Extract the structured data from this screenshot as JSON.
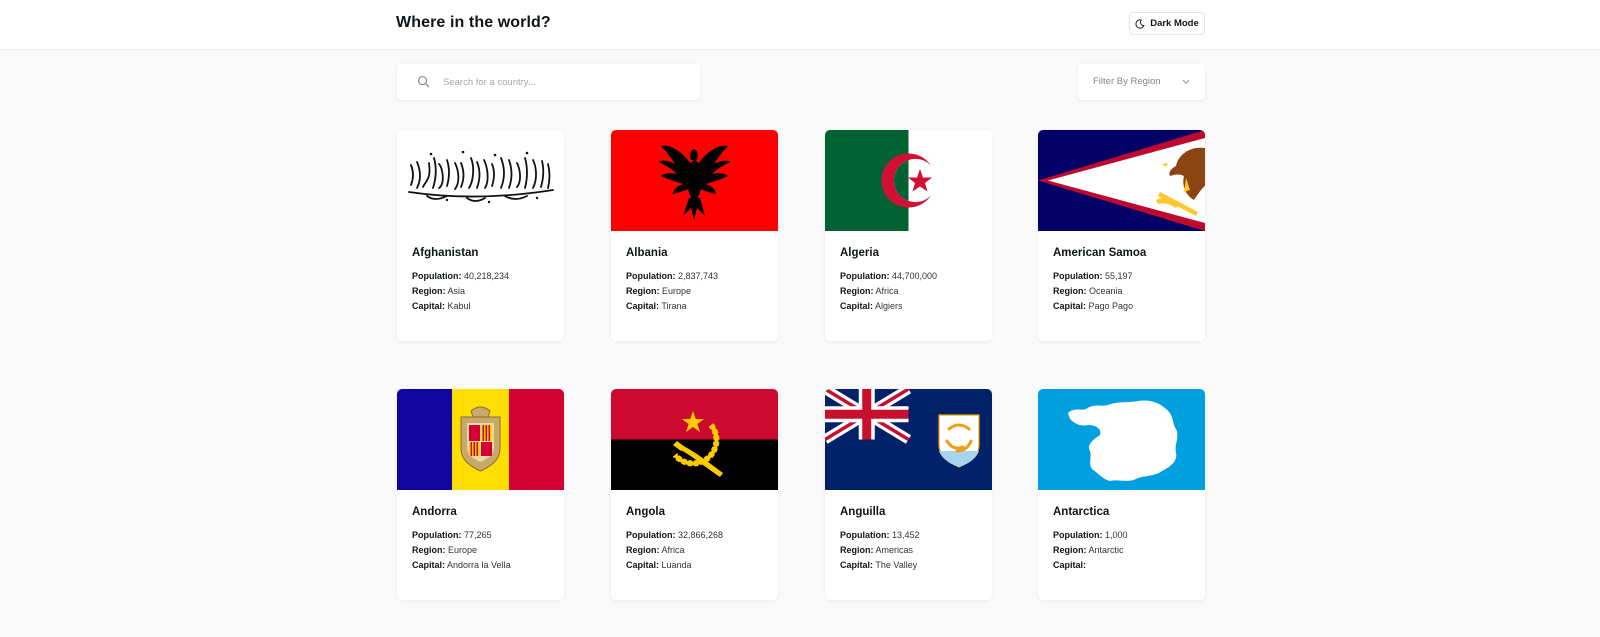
{
  "header": {
    "title": "Where in the world?",
    "theme_label": "Dark Mode",
    "theme_icon": "moon-icon"
  },
  "search": {
    "placeholder": "Search for a country...",
    "value": "",
    "icon": "search-icon"
  },
  "filter": {
    "label": "Filter By Region",
    "icon": "chevron-down-icon"
  },
  "field_labels": {
    "population": "Population:",
    "region": "Region:",
    "capital": "Capital:"
  },
  "countries": [
    {
      "name": "Afghanistan",
      "population": "40,218,234",
      "region": "Asia",
      "capital": "Kabul"
    },
    {
      "name": "Albania",
      "population": "2,837,743",
      "region": "Europe",
      "capital": "Tirana"
    },
    {
      "name": "Algeria",
      "population": "44,700,000",
      "region": "Africa",
      "capital": "Algiers"
    },
    {
      "name": "American Samoa",
      "population": "55,197",
      "region": "Oceania",
      "capital": "Pago Pago"
    },
    {
      "name": "Andorra",
      "population": "77,265",
      "region": "Europe",
      "capital": "Andorra la Vella"
    },
    {
      "name": "Angola",
      "population": "32,866,268",
      "region": "Africa",
      "capital": "Luanda"
    },
    {
      "name": "Anguilla",
      "population": "13,452",
      "region": "Americas",
      "capital": "The Valley"
    },
    {
      "name": "Antarctica",
      "population": "1,000",
      "region": "Antarctic",
      "capital": ""
    }
  ],
  "colors": {
    "background": "#fafafa",
    "element": "#ffffff",
    "text": "#111517",
    "input_placeholder": "#a6a6a6"
  }
}
